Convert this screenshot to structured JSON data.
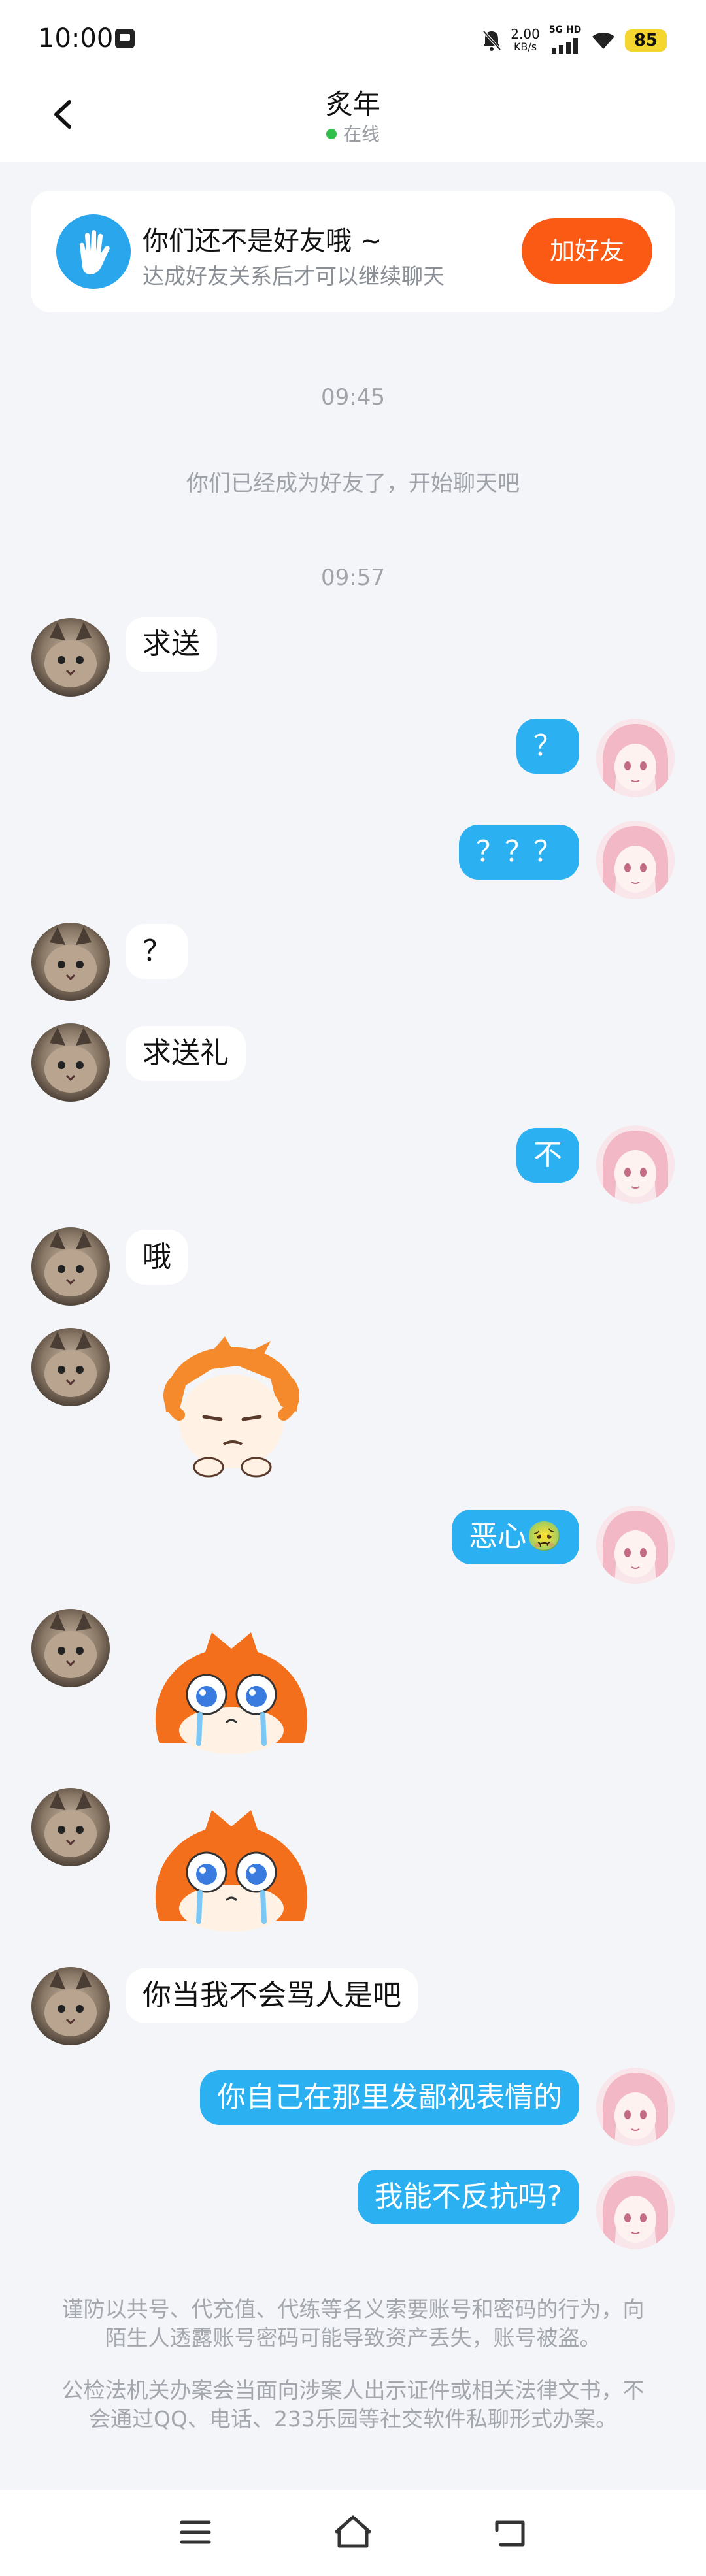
{
  "status_bar": {
    "time": "10:00",
    "speed_value": "2.00",
    "speed_unit": "KB/s",
    "network": "5G HD",
    "battery": "85"
  },
  "header": {
    "title": "炙年",
    "status": "在线"
  },
  "friend_card": {
    "title": "你们还不是好友哦 ~",
    "subtitle": "达成好友关系后才可以继续聊天",
    "button": "加好友"
  },
  "timeline": {
    "time1": "09:45",
    "notice": "你们已经成为好友了，开始聊天吧",
    "time2": "09:57"
  },
  "messages": [
    {
      "side": "left",
      "text": "求送"
    },
    {
      "side": "right",
      "text": "？"
    },
    {
      "side": "right",
      "text": "？？？"
    },
    {
      "side": "left",
      "text": "？"
    },
    {
      "side": "left",
      "text": "求送礼"
    },
    {
      "side": "right",
      "text": "不"
    },
    {
      "side": "left",
      "text": "哦"
    },
    {
      "side": "left",
      "sticker": "annoyed-orange-character-sticker"
    },
    {
      "side": "right",
      "text": "恶心🤢"
    },
    {
      "side": "left",
      "sticker": "crying-orange-character-sticker"
    },
    {
      "side": "left",
      "sticker": "crying-orange-character-sticker"
    },
    {
      "side": "left",
      "text": "你当我不会骂人是吧"
    },
    {
      "side": "right",
      "text": "你自己在那里发鄙视表情的"
    },
    {
      "side": "right",
      "text": "我能不反抗吗?"
    }
  ],
  "footer": {
    "warning_1": "谨防以共号、代充值、代练等名义索要账号和密码的行为，向陌生人透露账号密码可能导致资产丢失，账号被盗。",
    "warning_2": "公检法机关办案会当面向涉案人出示证件或相关法律文书，不会通过QQ、电话、233乐园等社交软件私聊形式办案。"
  },
  "colors": {
    "accent_blue": "#2bb0f2",
    "add_friend_orange": "#fb5a14",
    "background": "#f3f5f8",
    "online_green": "#2fbf4a"
  },
  "icons": [
    "back-arrow-icon",
    "waving-hand-icon",
    "menu-icon",
    "home-icon",
    "return-icon"
  ]
}
